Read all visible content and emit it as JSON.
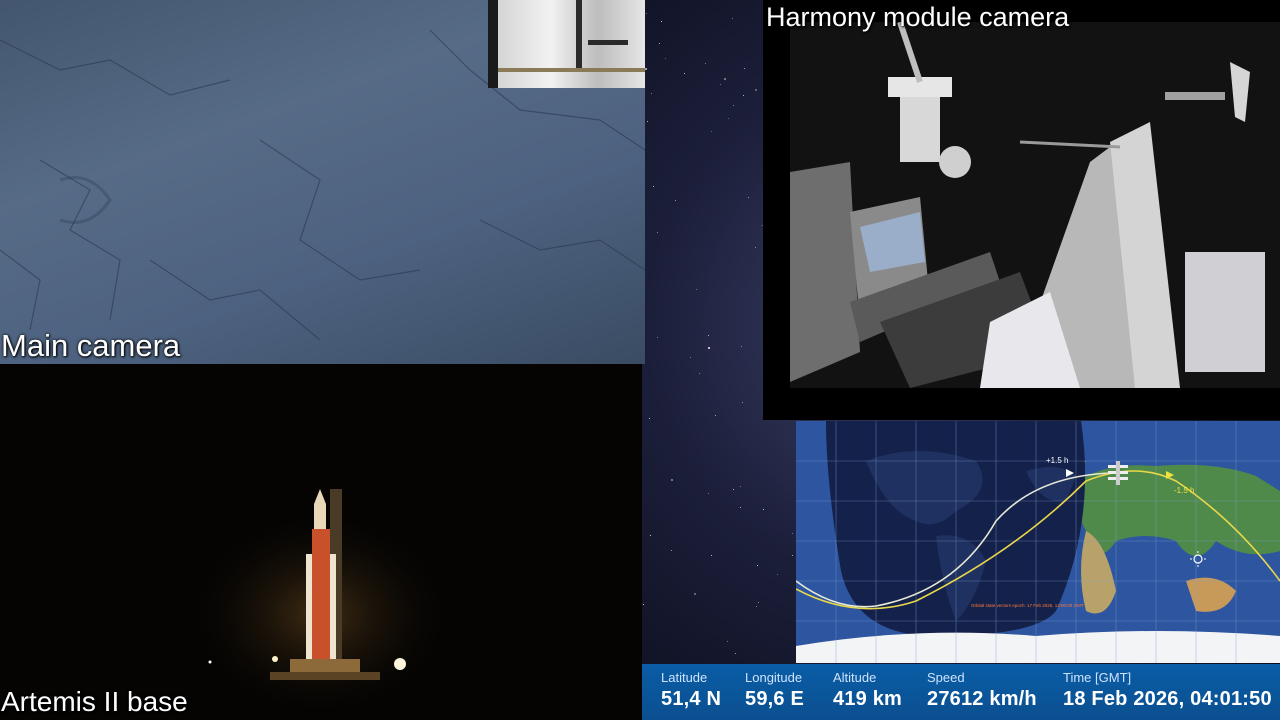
{
  "captions": {
    "main_camera": "Main camera",
    "harmony_camera": "Harmony module camera",
    "artemis_base": "Artemis II base"
  },
  "tracker": {
    "past_marker": "-1.5 h",
    "future_marker": "+1.5 h",
    "epoch_note": "Orbital state vectors epoch: 17 Feb 2026, 13:00:00 GMT"
  },
  "telemetry": {
    "latitude_label": "Latitude",
    "latitude_value": "51,4 N",
    "longitude_label": "Longitude",
    "longitude_value": "59,6 E",
    "altitude_label": "Altitude",
    "altitude_value": "419 km",
    "speed_label": "Speed",
    "speed_value": "27612 km/h",
    "time_label": "Time [GMT]",
    "time_value": "18 Feb 2026, 04:01:50"
  },
  "colors": {
    "telemetry_bar": "#0a5da6",
    "ocean": "#2e55a0",
    "night_side": "#14214a",
    "track_past": "#e8e8d8",
    "track_future": "#e8d84a"
  },
  "icons": [
    "iss-icon",
    "sun-icon",
    "rocket-icon"
  ]
}
